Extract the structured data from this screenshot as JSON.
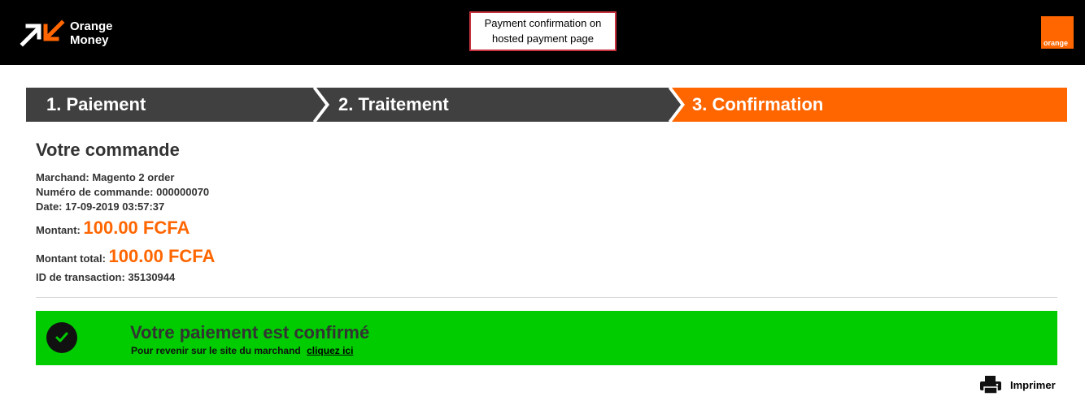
{
  "header": {
    "brand_line1": "Orange",
    "brand_line2": "Money",
    "callout_line1": "Payment confirmation on",
    "callout_line2": "hosted payment page",
    "orange_logo_text": "orange",
    "background": "#000000"
  },
  "steps": [
    {
      "label": "1. Paiement",
      "status": "done"
    },
    {
      "label": "2. Traitement",
      "status": "done"
    },
    {
      "label": "3. Confirmation",
      "status": "active"
    }
  ],
  "order": {
    "title": "Votre commande",
    "merchant": "Marchand: Magento 2 order",
    "order_number": "Numéro de commande: 000000070",
    "date": "Date: 17-09-2019 03:57:37",
    "amount_label": "Montant:",
    "amount_value": "100.00 FCFA",
    "total_label": "Montant total:",
    "total_value": "100.00 FCFA",
    "transaction": "ID de transaction: 35130944"
  },
  "confirmation": {
    "title": "Votre paiement est confirmé",
    "subtitle": "Pour revenir sur le site du marchand",
    "link_label": "cliquez ici",
    "icon": "check-circle-icon",
    "background": "#00cc00"
  },
  "print": {
    "label": "Imprimer",
    "icon": "printer-icon"
  },
  "colors": {
    "accent": "#ff6600",
    "step_dark": "#404040",
    "success": "#00cc00"
  }
}
